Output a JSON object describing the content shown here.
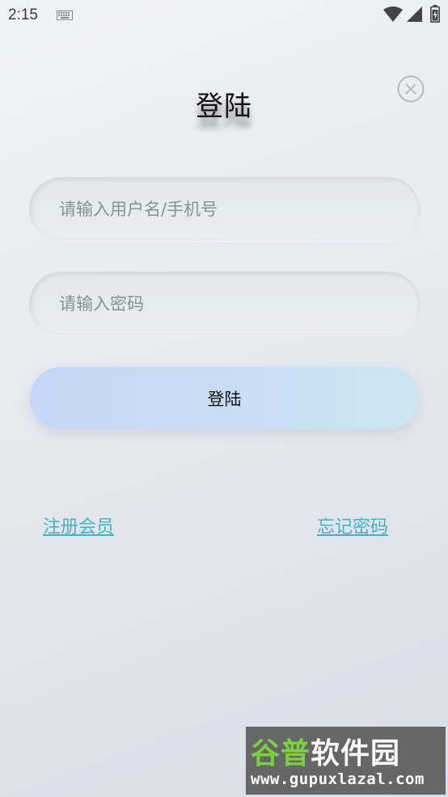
{
  "status_bar": {
    "time": "2:15",
    "icons": [
      "keyboard-icon",
      "wifi-icon",
      "signal-icon",
      "battery-icon"
    ]
  },
  "header": {
    "title": "登陆",
    "close_icon": "close-circle-icon"
  },
  "form": {
    "username_placeholder": "请输入用户名/手机号",
    "username_value": "",
    "password_placeholder": "请输入密码",
    "password_value": "",
    "login_label": "登陆"
  },
  "links": {
    "register": "注册会员",
    "forgot_password": "忘记密码"
  },
  "watermark": {
    "brand_green": "谷普",
    "brand_white": "软件园",
    "url": "www.gupuxlazal.com"
  },
  "colors": {
    "link": "#3fb6c3",
    "button_gradient_start": "#c6d6f6",
    "button_gradient_end": "#cde6f2"
  }
}
